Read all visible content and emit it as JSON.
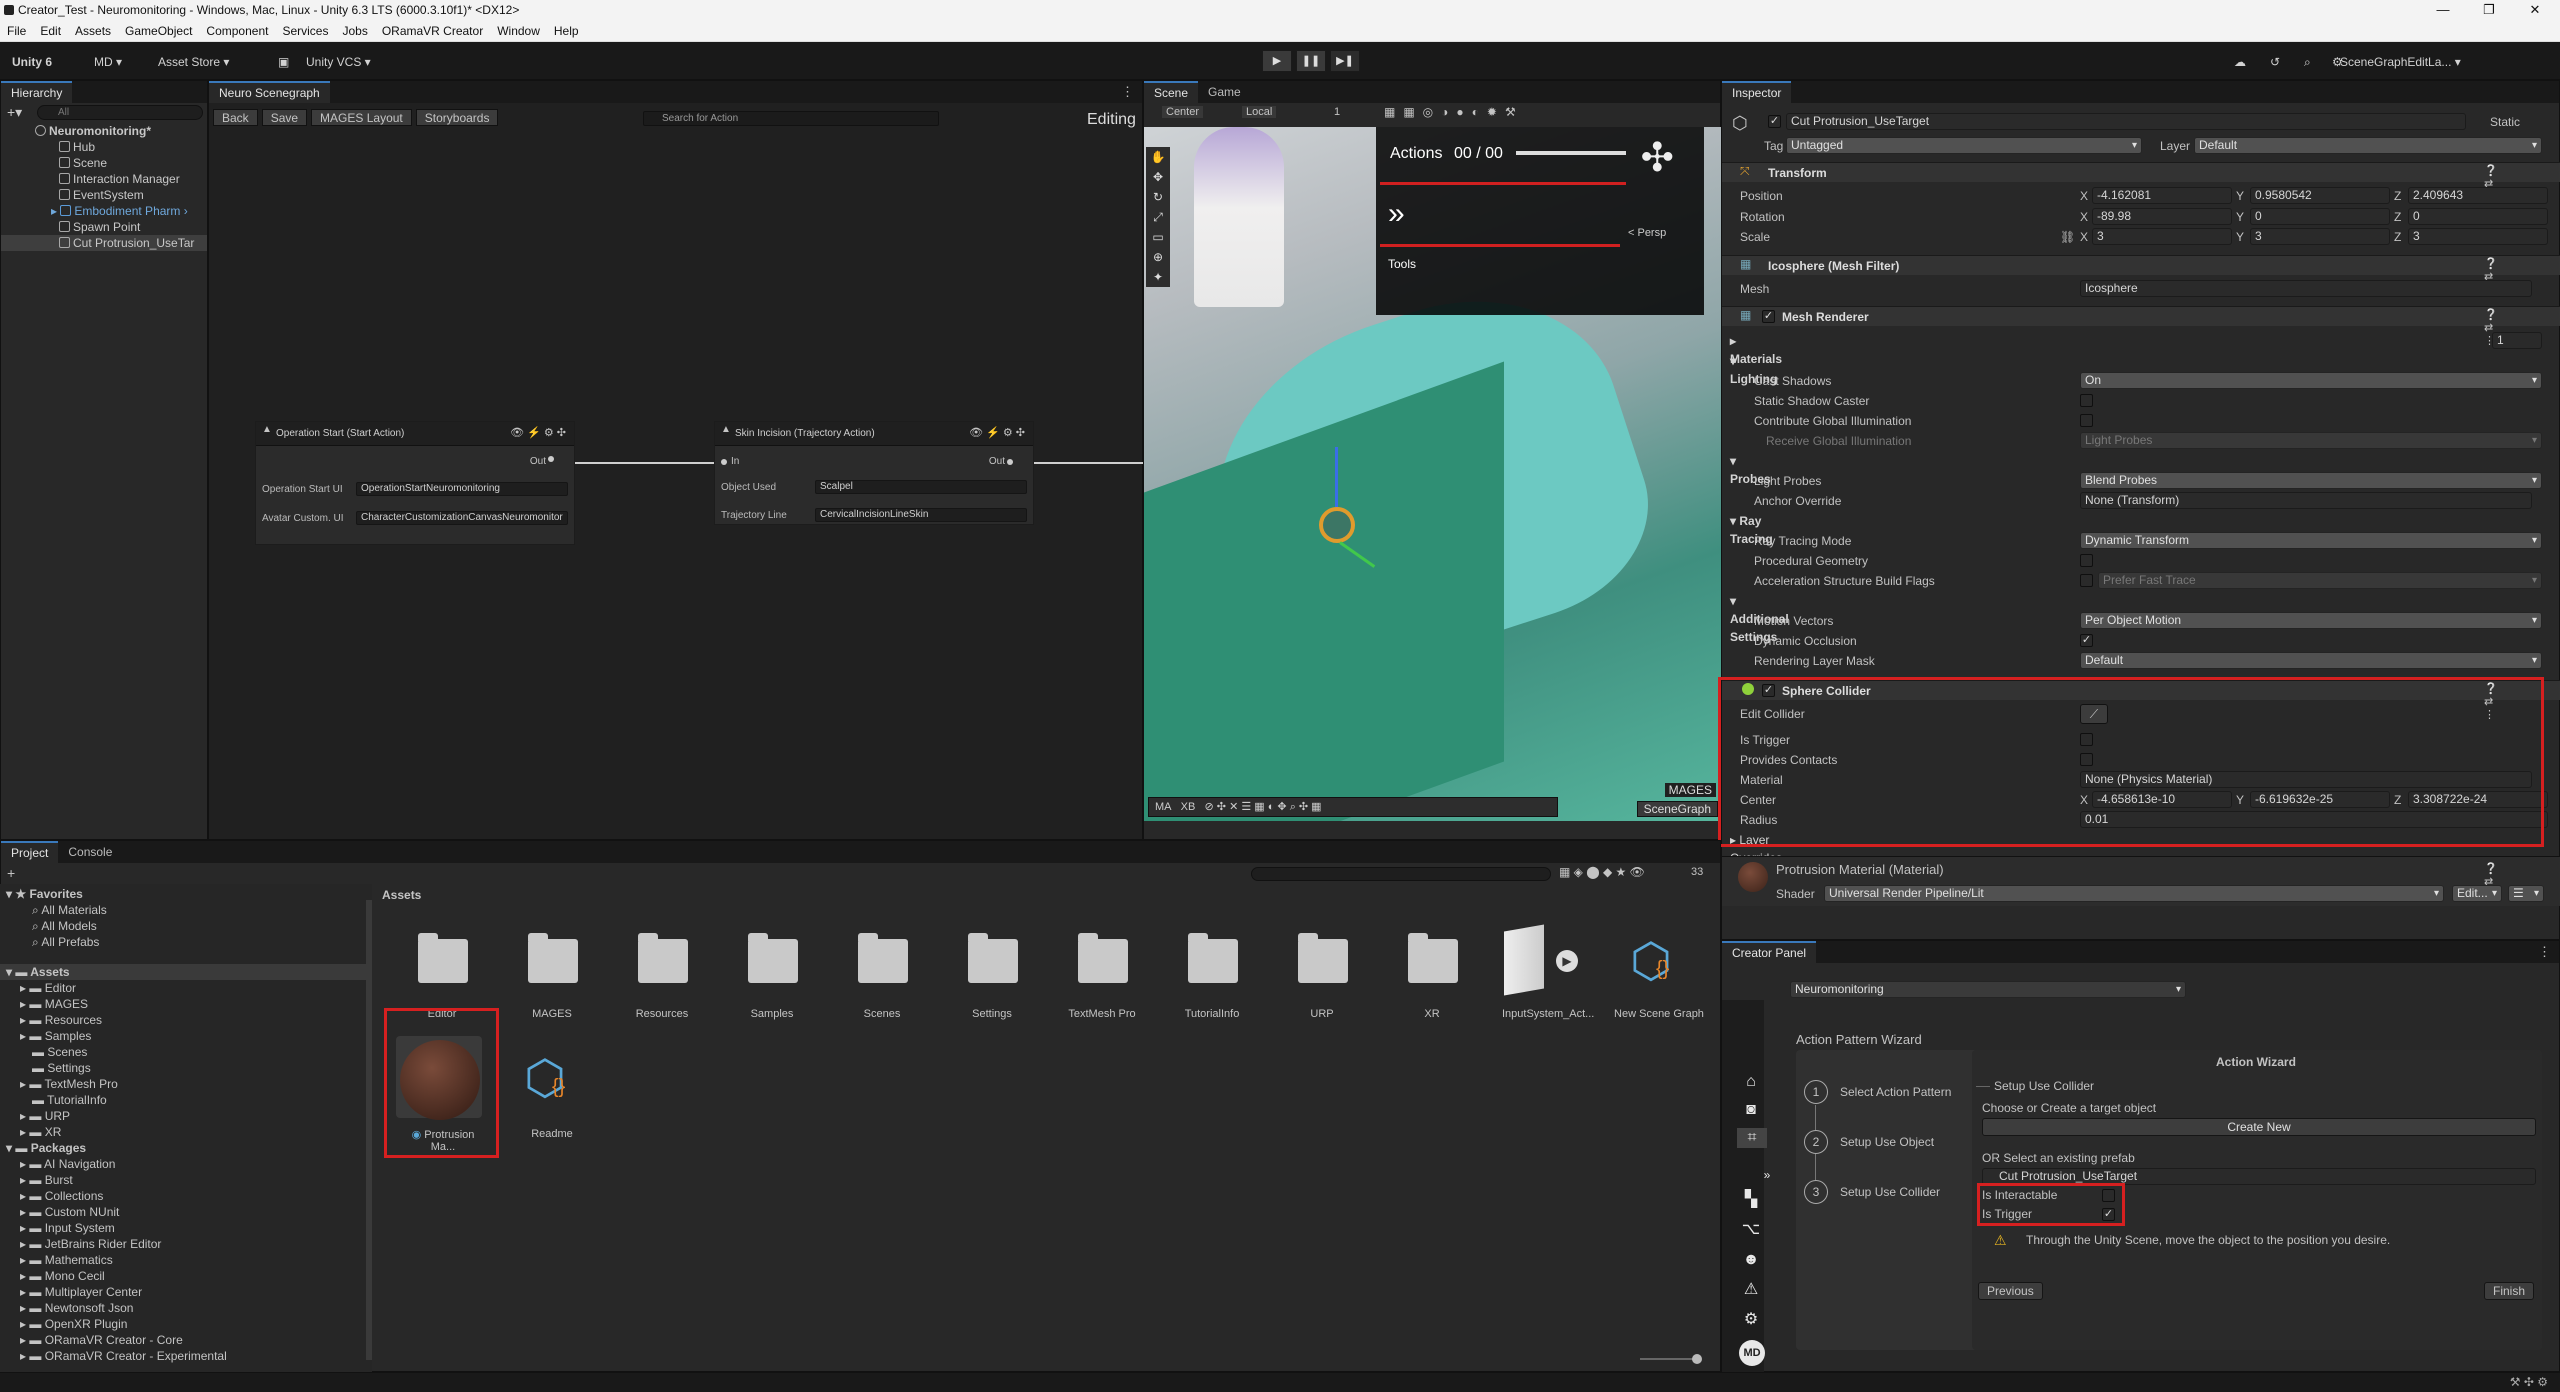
{
  "window": {
    "title": "Creator_Test - Neuromonitoring - Windows, Mac, Linux - Unity 6.3 LTS (6000.3.10f1)* <DX12>",
    "controls": [
      "—",
      "❐",
      "✕"
    ]
  },
  "menu": [
    "File",
    "Edit",
    "Assets",
    "GameObject",
    "Component",
    "Services",
    "Jobs",
    "ORamaVR Creator",
    "Window",
    "Help"
  ],
  "toolbar": {
    "unity": "Unity 6",
    "account": "MD ▾",
    "asset_store": "Asset Store ▾",
    "vcs": "Unity VCS ▾",
    "layout": "SceneGraphEditLa... ▾"
  },
  "hierarchy": {
    "tab": "Hierarchy",
    "search_placeholder": "All",
    "root": "Neuromonitoring*",
    "items": [
      "Hub",
      "Scene",
      "Interaction Manager",
      "EventSystem",
      "Embodiment Pharm",
      "Spawn Point",
      "Cut Protrusion_UseTar"
    ]
  },
  "scenegraph": {
    "tab": "Neuro Scenegraph",
    "buttons": [
      "Back",
      "Save",
      "MAGES Layout",
      "Storyboards"
    ],
    "search_placeholder": "Search for Action",
    "mode": "Editing",
    "node1": {
      "title": "Operation Start (Start Action)",
      "out": "Out",
      "fields": [
        {
          "label": "Operation Start UI",
          "value": "OperationStartNeuromonitoring"
        },
        {
          "label": "Avatar Custom. UI",
          "value": "CharacterCustomizationCanvasNeuromonitor"
        }
      ]
    },
    "node2": {
      "title": "Skin Incision (Trajectory Action)",
      "in": "In",
      "out": "Out",
      "fields": [
        {
          "label": "Object Used",
          "value": "Scalpel"
        },
        {
          "label": "Trajectory Line",
          "value": "CervicalIncisionLineSkin"
        }
      ]
    }
  },
  "scene": {
    "tabs": [
      "Scene",
      "Game"
    ],
    "pivot": "Center",
    "space": "Local",
    "snap": "1",
    "actions_label": "Actions",
    "actions_count": "00 / 00",
    "tools_label": "Tools",
    "persp": "< Persp",
    "mages_label": "MAGES",
    "scenegraph_btn": "SceneGraph",
    "bottom_tools": [
      "MA",
      "XB"
    ]
  },
  "inspector": {
    "tab": "Inspector",
    "object_name": "Cut Protrusion_UseTarget",
    "static": "Static",
    "tag_label": "Tag",
    "tag": "Untagged",
    "layer_label": "Layer",
    "layer": "Default",
    "transform": {
      "title": "Transform",
      "position": {
        "label": "Position",
        "x": "-4.162081",
        "y": "0.9580542",
        "z": "2.409643"
      },
      "rotation": {
        "label": "Rotation",
        "x": "-89.98",
        "y": "0",
        "z": "0"
      },
      "scale": {
        "label": "Scale",
        "x": "3",
        "y": "3",
        "z": "3"
      }
    },
    "mesh_filter": {
      "title": "Icosphere (Mesh Filter)",
      "mesh_label": "Mesh",
      "mesh": "Icosphere"
    },
    "mesh_renderer": {
      "title": "Mesh Renderer",
      "materials": "Materials",
      "materials_count": "1",
      "lighting": "Lighting",
      "cast_shadows": "Cast Shadows",
      "cast_shadows_val": "On",
      "static_shadow": "Static Shadow Caster",
      "contribute_gi": "Contribute Global Illumination",
      "receive_gi": "Receive Global Illumination",
      "receive_gi_val": "Light Probes",
      "probes": "Probes",
      "light_probes": "Light Probes",
      "light_probes_val": "Blend Probes",
      "anchor_override": "Anchor Override",
      "anchor_override_val": "None (Transform)",
      "ray_tracing": "Ray Tracing",
      "rt_mode": "Ray Tracing Mode",
      "rt_mode_val": "Dynamic Transform",
      "procedural": "Procedural Geometry",
      "accel": "Acceleration Structure Build Flags",
      "accel_val": "Prefer Fast Trace",
      "additional": "Additional Settings",
      "motion_vectors": "Motion Vectors",
      "motion_vectors_val": "Per Object Motion",
      "dynamic_occlusion": "Dynamic Occlusion",
      "rendering_layer": "Rendering Layer Mask",
      "rendering_layer_val": "Default"
    },
    "sphere_collider": {
      "title": "Sphere Collider",
      "edit": "Edit Collider",
      "is_trigger": "Is Trigger",
      "provides_contacts": "Provides Contacts",
      "material": "Material",
      "material_val": "None (Physics Material)",
      "center": "Center",
      "center_x": "-4.658613e-10",
      "center_y": "-6.619632e-25",
      "center_z": "3.308722e-24",
      "radius": "Radius",
      "radius_val": "0.01",
      "layer_overrides": "Layer Overrides"
    },
    "material": {
      "name": "Protrusion Material (Material)",
      "shader_label": "Shader",
      "shader": "Universal Render Pipeline/Lit",
      "edit": "Edit..."
    }
  },
  "creator_panel": {
    "tab": "Creator Panel",
    "project": "Neuromonitoring",
    "wizard_title": "Action Pattern Wizard",
    "steps": [
      {
        "num": "1",
        "label": "Select Action Pattern"
      },
      {
        "num": "2",
        "label": "Setup Use Object"
      },
      {
        "num": "3",
        "label": "Setup Use Collider"
      }
    ],
    "action_wizard": "Action Wizard",
    "section": "Setup Use Collider",
    "choose": "Choose or Create a target object",
    "create_new": "Create New",
    "or_select": "OR Select an existing prefab",
    "prefab": "Cut Protrusion_UseTarget",
    "is_interactable": "Is Interactable",
    "is_trigger": "Is Trigger",
    "hint": "Through the Unity Scene, move the object to the position you desire.",
    "previous": "Previous",
    "finish": "Finish",
    "avatar": "MD"
  },
  "project": {
    "tabs": [
      "Project",
      "Console"
    ],
    "count": "33",
    "favorites": "Favorites",
    "fav_items": [
      "All Materials",
      "All Models",
      "All Prefabs"
    ],
    "assets_label": "Assets",
    "asset_tree": [
      "Editor",
      "MAGES",
      "Resources",
      "Samples",
      "Scenes",
      "Settings",
      "TextMesh Pro",
      "TutorialInfo",
      "URP",
      "XR"
    ],
    "packages_label": "Packages",
    "packages": [
      "AI Navigation",
      "Burst",
      "Collections",
      "Custom NUnit",
      "Input System",
      "JetBrains Rider Editor",
      "Mathematics",
      "Mono Cecil",
      "Multiplayer Center",
      "Newtonsoft Json",
      "OpenXR Plugin",
      "ORamaVR Creator - Core",
      "ORamaVR Creator - Experimental"
    ],
    "breadcrumb": "Assets",
    "folders": [
      "Editor",
      "MAGES",
      "Resources",
      "Samples",
      "Scenes",
      "Settings",
      "TextMesh Pro",
      "TutorialInfo",
      "URP",
      "XR"
    ],
    "special": [
      "InputSystem_Act...",
      "New Scene Graph"
    ],
    "row2": [
      "Protrusion Ma...",
      "Readme"
    ]
  },
  "colors": {
    "accent": "#3a79bb",
    "highlight": "#d62020",
    "panel": "#282828"
  }
}
